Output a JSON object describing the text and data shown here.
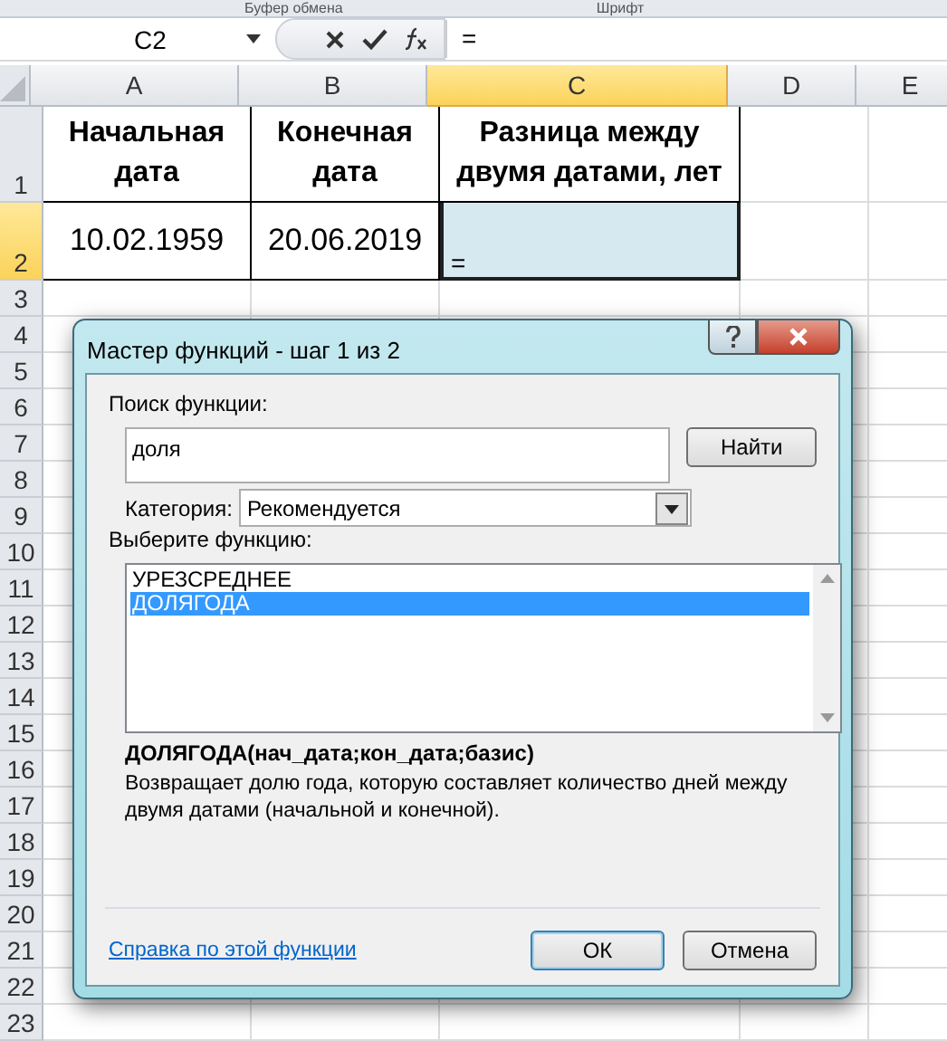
{
  "ribbon_groups": [
    "Буфер обмена",
    "Шрифт"
  ],
  "formula_bar": {
    "name_box": "C2",
    "formula": "="
  },
  "sheet": {
    "columns": [
      {
        "label": "A",
        "selected": false
      },
      {
        "label": "B",
        "selected": false
      },
      {
        "label": "C",
        "selected": true
      },
      {
        "label": "D",
        "selected": false
      },
      {
        "label": "E",
        "selected": false
      }
    ],
    "rows": [
      {
        "label": "1",
        "selected": false,
        "cells": [
          "Начальная дата",
          "Конечная дата",
          "Разница между двумя датами, лет"
        ]
      },
      {
        "label": "2",
        "selected": true,
        "cells": [
          "10.02.1959",
          "20.06.2019",
          "="
        ]
      },
      {
        "label": "3",
        "selected": false
      },
      {
        "label": "4",
        "selected": false
      },
      {
        "label": "5",
        "selected": false
      },
      {
        "label": "6",
        "selected": false
      },
      {
        "label": "7",
        "selected": false
      },
      {
        "label": "8",
        "selected": false
      },
      {
        "label": "9",
        "selected": false
      },
      {
        "label": "10",
        "selected": false
      },
      {
        "label": "11",
        "selected": false
      },
      {
        "label": "12",
        "selected": false
      },
      {
        "label": "13",
        "selected": false
      },
      {
        "label": "14",
        "selected": false
      },
      {
        "label": "15",
        "selected": false
      },
      {
        "label": "16",
        "selected": false
      },
      {
        "label": "17",
        "selected": false
      },
      {
        "label": "18",
        "selected": false
      },
      {
        "label": "19",
        "selected": false
      },
      {
        "label": "20",
        "selected": false
      },
      {
        "label": "21",
        "selected": false
      },
      {
        "label": "22",
        "selected": false
      },
      {
        "label": "23",
        "selected": false
      }
    ]
  },
  "dialog": {
    "title": "Мастер функций - шаг 1 из 2",
    "search_label": "Поиск функции:",
    "search_value": "доля",
    "find_button": "Найти",
    "category_label": "Категория:",
    "category_value": "Рекомендуется",
    "list_label": "Выберите функцию:",
    "functions": [
      {
        "name": "УРЕЗСРЕДНЕЕ",
        "selected": false
      },
      {
        "name": "ДОЛЯГОДА",
        "selected": true
      }
    ],
    "signature": "ДОЛЯГОДА(нач_дата;кон_дата;базис)",
    "description": "Возвращает долю года, которую составляет количество дней между двумя датами (начальной и конечной).",
    "help_link": "Справка по этой функции",
    "ok_button": "ОК",
    "cancel_button": "Отмена"
  }
}
